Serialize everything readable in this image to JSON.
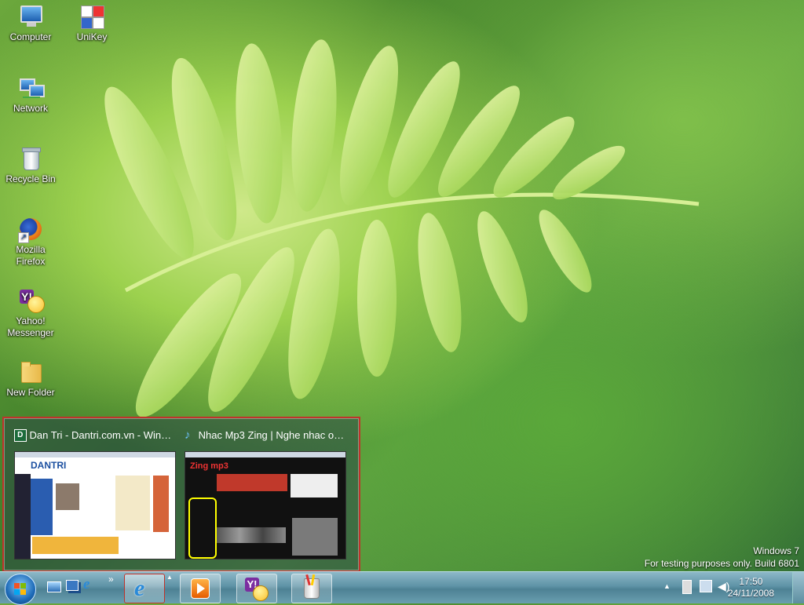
{
  "desktop": {
    "icons": [
      {
        "label": "Computer"
      },
      {
        "label": "UniKey"
      },
      {
        "label": "Network"
      },
      {
        "label": "Recycle Bin"
      },
      {
        "label": "Mozilla Firefox"
      },
      {
        "label": "Yahoo! Messenger"
      },
      {
        "label": "New Folder"
      }
    ],
    "watermark": {
      "line1": "Windows 7",
      "line2": "For testing purposes only. Build 6801"
    }
  },
  "peek": {
    "thumbnails": [
      {
        "title": "Dan Tri - Dantri.com.vn - Windo...",
        "icon": "dantri-icon",
        "site": "DANTRI"
      },
      {
        "title": "Nhac Mp3 Zing | Nghe nhac onl...",
        "icon": "music-note-icon",
        "site": "Zing mp3"
      }
    ]
  },
  "taskbar": {
    "start": "start-orb",
    "quicklaunch": [
      "show-desktop-icon",
      "switch-windows-icon",
      "internet-explorer-icon"
    ],
    "overflow": "»",
    "tray_arrow": "▲",
    "clock": {
      "time": "17:50",
      "date": "24/11/2008"
    }
  },
  "colors": {
    "highlight": "#c0332b",
    "taskbar": "#5e93a6"
  }
}
